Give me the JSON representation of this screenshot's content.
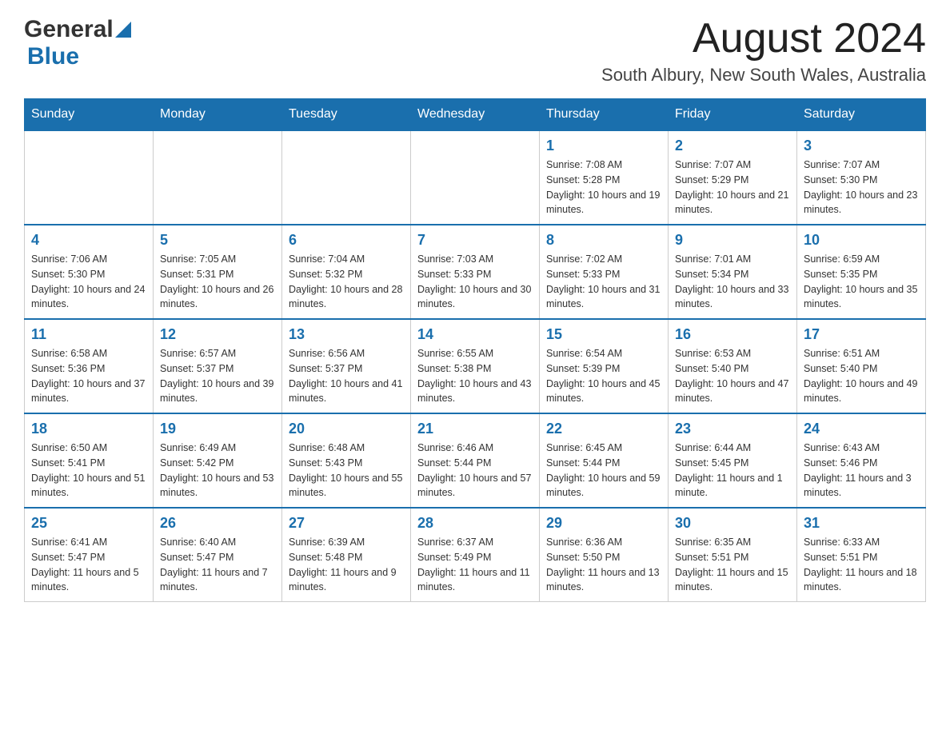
{
  "logo": {
    "general": "General",
    "blue": "Blue"
  },
  "header": {
    "month_year": "August 2024",
    "location": "South Albury, New South Wales, Australia"
  },
  "days_of_week": [
    "Sunday",
    "Monday",
    "Tuesday",
    "Wednesday",
    "Thursday",
    "Friday",
    "Saturday"
  ],
  "weeks": [
    [
      {
        "day": "",
        "info": ""
      },
      {
        "day": "",
        "info": ""
      },
      {
        "day": "",
        "info": ""
      },
      {
        "day": "",
        "info": ""
      },
      {
        "day": "1",
        "info": "Sunrise: 7:08 AM\nSunset: 5:28 PM\nDaylight: 10 hours and 19 minutes."
      },
      {
        "day": "2",
        "info": "Sunrise: 7:07 AM\nSunset: 5:29 PM\nDaylight: 10 hours and 21 minutes."
      },
      {
        "day": "3",
        "info": "Sunrise: 7:07 AM\nSunset: 5:30 PM\nDaylight: 10 hours and 23 minutes."
      }
    ],
    [
      {
        "day": "4",
        "info": "Sunrise: 7:06 AM\nSunset: 5:30 PM\nDaylight: 10 hours and 24 minutes."
      },
      {
        "day": "5",
        "info": "Sunrise: 7:05 AM\nSunset: 5:31 PM\nDaylight: 10 hours and 26 minutes."
      },
      {
        "day": "6",
        "info": "Sunrise: 7:04 AM\nSunset: 5:32 PM\nDaylight: 10 hours and 28 minutes."
      },
      {
        "day": "7",
        "info": "Sunrise: 7:03 AM\nSunset: 5:33 PM\nDaylight: 10 hours and 30 minutes."
      },
      {
        "day": "8",
        "info": "Sunrise: 7:02 AM\nSunset: 5:33 PM\nDaylight: 10 hours and 31 minutes."
      },
      {
        "day": "9",
        "info": "Sunrise: 7:01 AM\nSunset: 5:34 PM\nDaylight: 10 hours and 33 minutes."
      },
      {
        "day": "10",
        "info": "Sunrise: 6:59 AM\nSunset: 5:35 PM\nDaylight: 10 hours and 35 minutes."
      }
    ],
    [
      {
        "day": "11",
        "info": "Sunrise: 6:58 AM\nSunset: 5:36 PM\nDaylight: 10 hours and 37 minutes."
      },
      {
        "day": "12",
        "info": "Sunrise: 6:57 AM\nSunset: 5:37 PM\nDaylight: 10 hours and 39 minutes."
      },
      {
        "day": "13",
        "info": "Sunrise: 6:56 AM\nSunset: 5:37 PM\nDaylight: 10 hours and 41 minutes."
      },
      {
        "day": "14",
        "info": "Sunrise: 6:55 AM\nSunset: 5:38 PM\nDaylight: 10 hours and 43 minutes."
      },
      {
        "day": "15",
        "info": "Sunrise: 6:54 AM\nSunset: 5:39 PM\nDaylight: 10 hours and 45 minutes."
      },
      {
        "day": "16",
        "info": "Sunrise: 6:53 AM\nSunset: 5:40 PM\nDaylight: 10 hours and 47 minutes."
      },
      {
        "day": "17",
        "info": "Sunrise: 6:51 AM\nSunset: 5:40 PM\nDaylight: 10 hours and 49 minutes."
      }
    ],
    [
      {
        "day": "18",
        "info": "Sunrise: 6:50 AM\nSunset: 5:41 PM\nDaylight: 10 hours and 51 minutes."
      },
      {
        "day": "19",
        "info": "Sunrise: 6:49 AM\nSunset: 5:42 PM\nDaylight: 10 hours and 53 minutes."
      },
      {
        "day": "20",
        "info": "Sunrise: 6:48 AM\nSunset: 5:43 PM\nDaylight: 10 hours and 55 minutes."
      },
      {
        "day": "21",
        "info": "Sunrise: 6:46 AM\nSunset: 5:44 PM\nDaylight: 10 hours and 57 minutes."
      },
      {
        "day": "22",
        "info": "Sunrise: 6:45 AM\nSunset: 5:44 PM\nDaylight: 10 hours and 59 minutes."
      },
      {
        "day": "23",
        "info": "Sunrise: 6:44 AM\nSunset: 5:45 PM\nDaylight: 11 hours and 1 minute."
      },
      {
        "day": "24",
        "info": "Sunrise: 6:43 AM\nSunset: 5:46 PM\nDaylight: 11 hours and 3 minutes."
      }
    ],
    [
      {
        "day": "25",
        "info": "Sunrise: 6:41 AM\nSunset: 5:47 PM\nDaylight: 11 hours and 5 minutes."
      },
      {
        "day": "26",
        "info": "Sunrise: 6:40 AM\nSunset: 5:47 PM\nDaylight: 11 hours and 7 minutes."
      },
      {
        "day": "27",
        "info": "Sunrise: 6:39 AM\nSunset: 5:48 PM\nDaylight: 11 hours and 9 minutes."
      },
      {
        "day": "28",
        "info": "Sunrise: 6:37 AM\nSunset: 5:49 PM\nDaylight: 11 hours and 11 minutes."
      },
      {
        "day": "29",
        "info": "Sunrise: 6:36 AM\nSunset: 5:50 PM\nDaylight: 11 hours and 13 minutes."
      },
      {
        "day": "30",
        "info": "Sunrise: 6:35 AM\nSunset: 5:51 PM\nDaylight: 11 hours and 15 minutes."
      },
      {
        "day": "31",
        "info": "Sunrise: 6:33 AM\nSunset: 5:51 PM\nDaylight: 11 hours and 18 minutes."
      }
    ]
  ]
}
